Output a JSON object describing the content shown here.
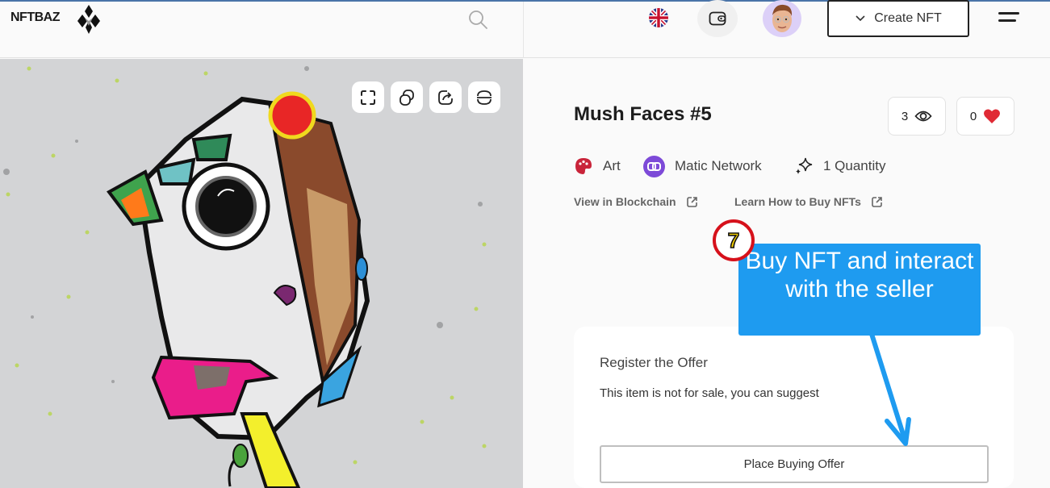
{
  "header": {
    "logo_text": "NFTBAZ",
    "search_icon": "search-icon",
    "language_icon": "uk-flag-icon",
    "wallet_icon": "wallet-icon",
    "avatar_icon": "user-avatar",
    "create_button_label": "Create NFT",
    "menu_icon": "hamburger-menu-icon"
  },
  "artwork": {
    "tools": [
      {
        "name": "fullscreen-icon"
      },
      {
        "name": "copy-icon"
      },
      {
        "name": "share-icon"
      },
      {
        "name": "scan-icon"
      }
    ]
  },
  "nft": {
    "title": "Mush Faces #5",
    "views": "3",
    "likes": "0",
    "category": "Art",
    "network": "Matic Network",
    "quantity": "1 Quantity",
    "view_blockchain_label": "View in Blockchain",
    "learn_label": "Learn How to Buy NFTs"
  },
  "offer": {
    "title": "Register the Offer",
    "description": "This item is not for sale, you can suggest",
    "button_label": "Place Buying Offer"
  },
  "annotation": {
    "step_number": "7",
    "callout_text": "Buy NFT and interact with the seller",
    "callout_color": "#1e9bf0",
    "badge_color": "#d6111b"
  }
}
